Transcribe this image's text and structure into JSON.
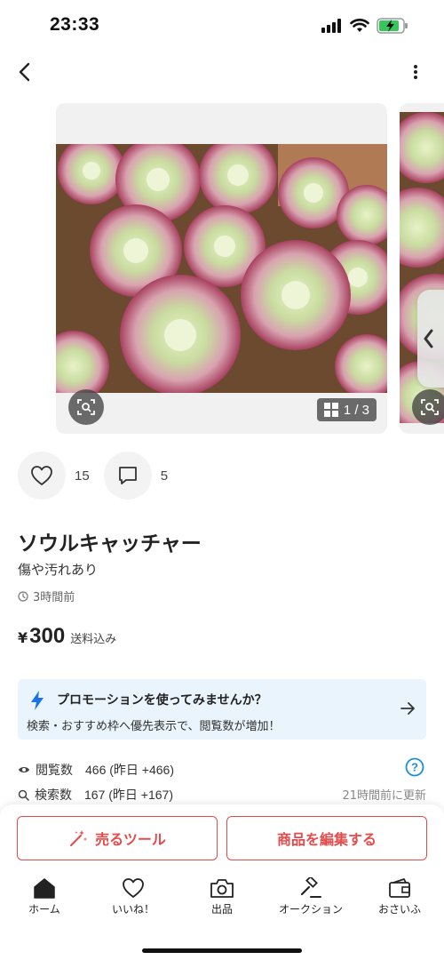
{
  "status_bar": {
    "time": "23:33"
  },
  "product": {
    "title": "ソウルキャッチャー",
    "condition": "傷や汚れあり",
    "posted": "3時間前",
    "price_currency": "¥",
    "price": "300",
    "shipping": "送料込み",
    "likes": "15",
    "comments": "5",
    "image_counter": "1 / 3"
  },
  "promo": {
    "title": "プロモーションを使ってみませんか？",
    "description": "検索・おすすめ枠へ優先表示で、閲覧数が増加！"
  },
  "stats": {
    "views_label": "閲覧数",
    "views_value": "466 (昨日 +466)",
    "searches_label": "検索数",
    "searches_value": "167 (昨日 +167)",
    "updated": "21時間前に更新"
  },
  "actions": {
    "sell_tool": "売るツール",
    "edit": "商品を編集する"
  },
  "tabs": [
    {
      "label": "ホーム",
      "icon": "home-icon"
    },
    {
      "label": "いいね！",
      "icon": "heart-icon"
    },
    {
      "label": "出品",
      "icon": "camera-icon"
    },
    {
      "label": "オークション",
      "icon": "gavel-icon"
    },
    {
      "label": "おさいふ",
      "icon": "wallet-icon"
    }
  ],
  "colors": {
    "accent": "#e64a4a",
    "promo_bg": "#eaf4fc",
    "promo_icon": "#1a73e8",
    "help": "#1a8fd8"
  }
}
